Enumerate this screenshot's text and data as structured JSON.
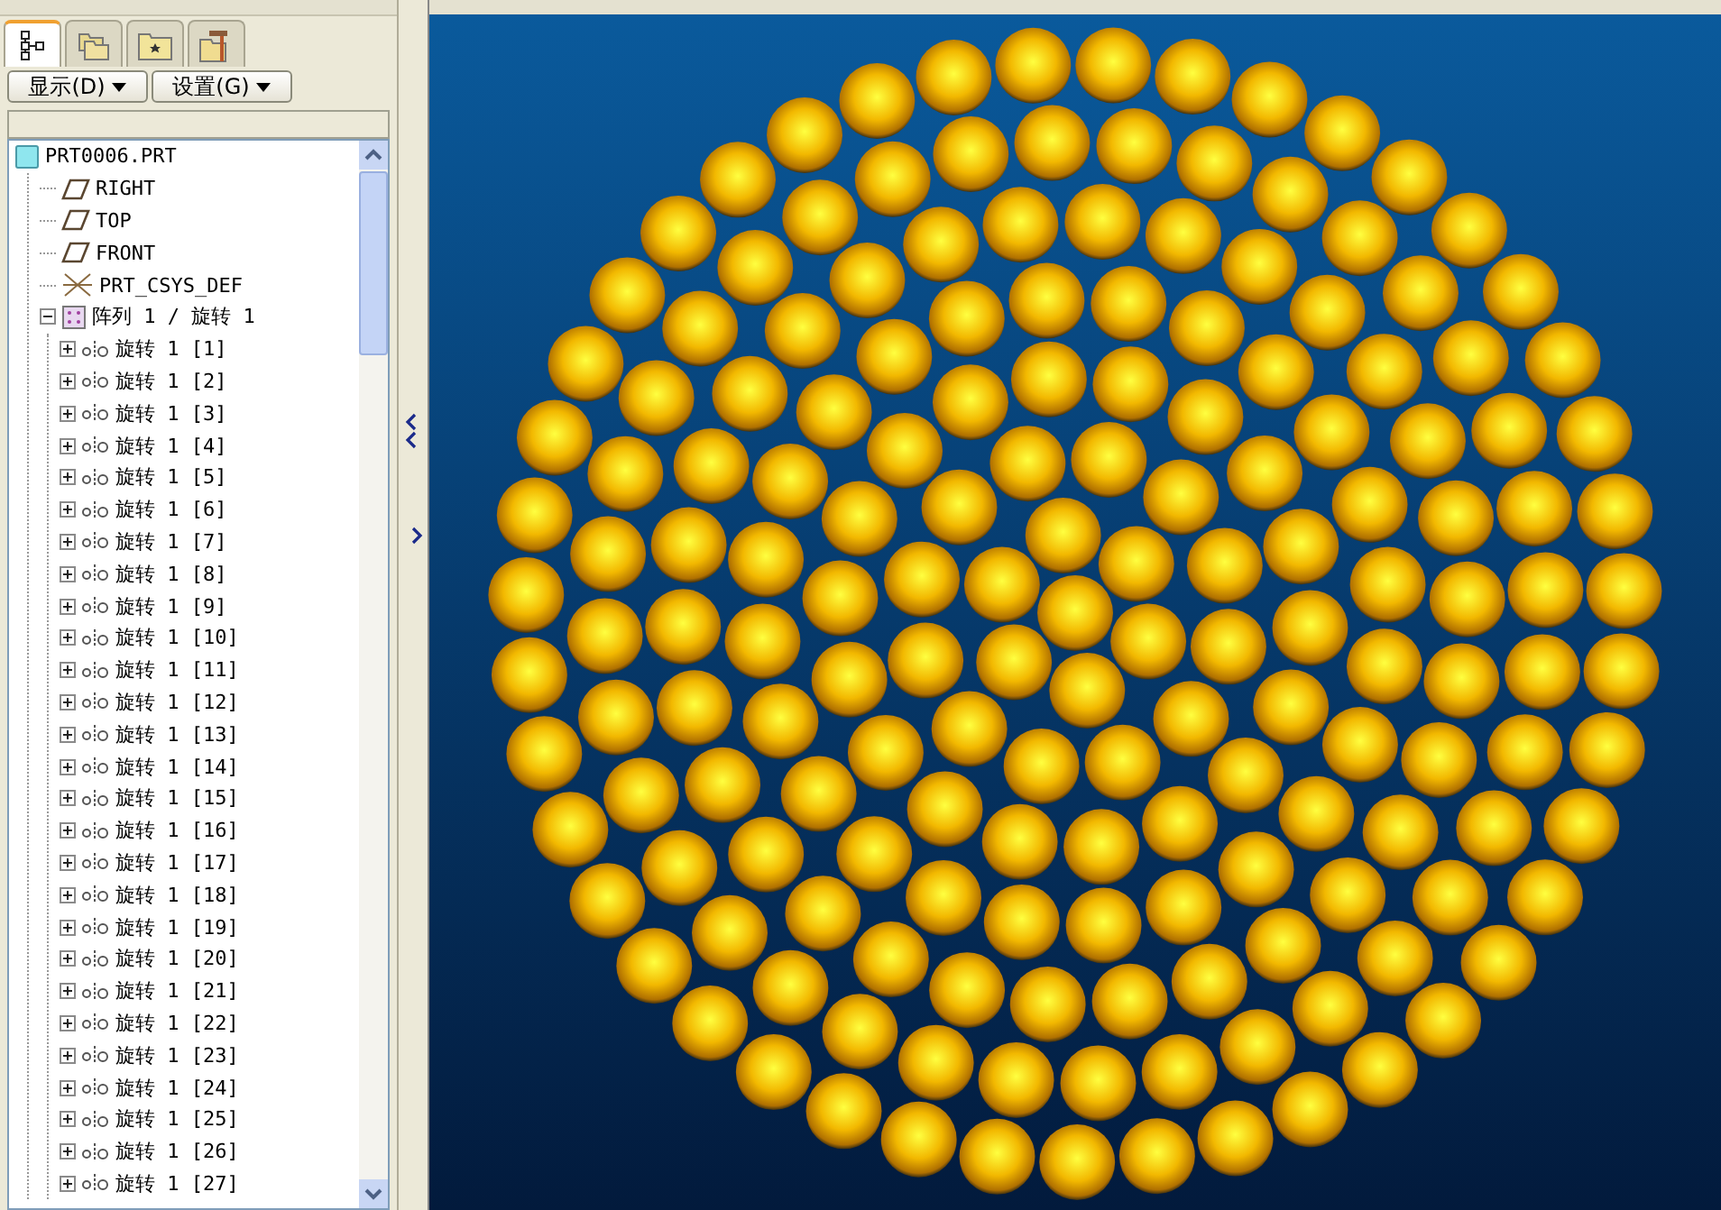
{
  "panel_tabs": [
    {
      "kind": "model-tree",
      "selected": true
    },
    {
      "kind": "folders",
      "selected": false
    },
    {
      "kind": "favorites",
      "selected": false
    },
    {
      "kind": "tools",
      "selected": false
    }
  ],
  "panel_buttons": [
    {
      "label": "显示(D)"
    },
    {
      "label": "设置(G)"
    }
  ],
  "model_tree": {
    "label": "PRT0006.PRT",
    "kind": "part",
    "children": [
      {
        "label": "RIGHT",
        "kind": "datum-plane"
      },
      {
        "label": "TOP",
        "kind": "datum-plane"
      },
      {
        "label": "FRONT",
        "kind": "datum-plane"
      },
      {
        "label": "PRT_CSYS_DEF",
        "kind": "csys"
      },
      {
        "label": "阵列 1 / 旋转 1",
        "kind": "pattern",
        "expanded": true,
        "children": [
          {
            "label": "旋转 1 [1]",
            "kind": "revolve",
            "expanded": false
          },
          {
            "label": "旋转 1 [2]",
            "kind": "revolve",
            "expanded": false
          },
          {
            "label": "旋转 1 [3]",
            "kind": "revolve",
            "expanded": false
          },
          {
            "label": "旋转 1 [4]",
            "kind": "revolve",
            "expanded": false
          },
          {
            "label": "旋转 1 [5]",
            "kind": "revolve",
            "expanded": false
          },
          {
            "label": "旋转 1 [6]",
            "kind": "revolve",
            "expanded": false
          },
          {
            "label": "旋转 1 [7]",
            "kind": "revolve",
            "expanded": false
          },
          {
            "label": "旋转 1 [8]",
            "kind": "revolve",
            "expanded": false
          },
          {
            "label": "旋转 1 [9]",
            "kind": "revolve",
            "expanded": false
          },
          {
            "label": "旋转 1 [10]",
            "kind": "revolve",
            "expanded": false
          },
          {
            "label": "旋转 1 [11]",
            "kind": "revolve",
            "expanded": false
          },
          {
            "label": "旋转 1 [12]",
            "kind": "revolve",
            "expanded": false
          },
          {
            "label": "旋转 1 [13]",
            "kind": "revolve",
            "expanded": false
          },
          {
            "label": "旋转 1 [14]",
            "kind": "revolve",
            "expanded": false
          },
          {
            "label": "旋转 1 [15]",
            "kind": "revolve",
            "expanded": false
          },
          {
            "label": "旋转 1 [16]",
            "kind": "revolve",
            "expanded": false
          },
          {
            "label": "旋转 1 [17]",
            "kind": "revolve",
            "expanded": false
          },
          {
            "label": "旋转 1 [18]",
            "kind": "revolve",
            "expanded": false
          },
          {
            "label": "旋转 1 [19]",
            "kind": "revolve",
            "expanded": false
          },
          {
            "label": "旋转 1 [20]",
            "kind": "revolve",
            "expanded": false
          },
          {
            "label": "旋转 1 [21]",
            "kind": "revolve",
            "expanded": false
          },
          {
            "label": "旋转 1 [22]",
            "kind": "revolve",
            "expanded": false
          },
          {
            "label": "旋转 1 [23]",
            "kind": "revolve",
            "expanded": false
          },
          {
            "label": "旋转 1 [24]",
            "kind": "revolve",
            "expanded": false
          },
          {
            "label": "旋转 1 [25]",
            "kind": "revolve",
            "expanded": false
          },
          {
            "label": "旋转 1 [26]",
            "kind": "revolve",
            "expanded": false
          },
          {
            "label": "旋转 1 [27]",
            "kind": "revolve",
            "expanded": false
          }
        ]
      }
    ]
  }
}
